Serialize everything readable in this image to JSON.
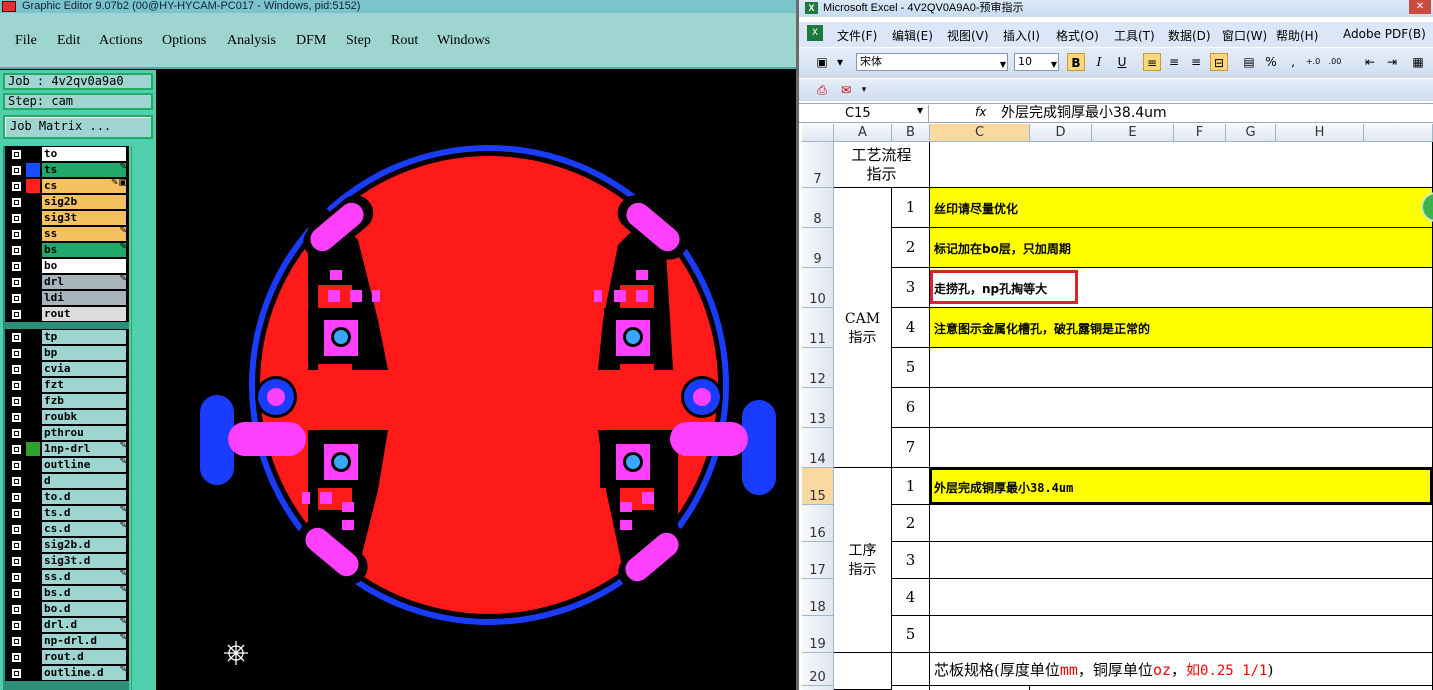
{
  "editor": {
    "title": "Graphic Editor 9.07b2 (00@HY-HYCAM-PC017 - Windows, pid:5152)",
    "menu": [
      "File",
      "Edit",
      "Actions",
      "Options",
      "Analysis",
      "DFM",
      "Step",
      "Rout",
      "Windows"
    ],
    "job_label": "Job : 4v2qv0a9a0",
    "step_label": "Step: cam",
    "job_matrix_button": "Job Matrix ...",
    "layers": [
      {
        "name": "to",
        "color": "#ffffff",
        "fill": "#000000",
        "marker": ""
      },
      {
        "name": "ts",
        "color": "#22a86a",
        "fill": "#1a4cff",
        "marker": "✎"
      },
      {
        "name": "cs",
        "color": "#f5c060",
        "fill": "#ff2020",
        "marker": "✎▣"
      },
      {
        "name": "sig2b",
        "color": "#f5c060",
        "fill": "#000000",
        "marker": ""
      },
      {
        "name": "sig3t",
        "color": "#f5c060",
        "fill": "#000000",
        "marker": ""
      },
      {
        "name": "ss",
        "color": "#f5c060",
        "fill": "#000000",
        "marker": "✎"
      },
      {
        "name": "bs",
        "color": "#22a86a",
        "fill": "#000000",
        "marker": "✎"
      },
      {
        "name": "bo",
        "color": "#ffffff",
        "fill": "#000000",
        "marker": ""
      },
      {
        "name": "drl",
        "color": "#a8b4bc",
        "fill": "#000000",
        "marker": "✎"
      },
      {
        "name": "ldi",
        "color": "#a8b4bc",
        "fill": "#000000",
        "marker": ""
      },
      {
        "name": "rout",
        "color": "#dcdcdc",
        "fill": "#000000",
        "marker": ""
      },
      {
        "name": "tp",
        "color": "#9fd5d1",
        "fill": "#000000",
        "marker": ""
      },
      {
        "name": "bp",
        "color": "#9fd5d1",
        "fill": "#000000",
        "marker": ""
      },
      {
        "name": "cvia",
        "color": "#9fd5d1",
        "fill": "#000000",
        "marker": ""
      },
      {
        "name": "fzt",
        "color": "#9fd5d1",
        "fill": "#000000",
        "marker": ""
      },
      {
        "name": "fzb",
        "color": "#9fd5d1",
        "fill": "#000000",
        "marker": ""
      },
      {
        "name": "roubk",
        "color": "#9fd5d1",
        "fill": "#000000",
        "marker": ""
      },
      {
        "name": "pthrou",
        "color": "#9fd5d1",
        "fill": "#000000",
        "marker": ""
      },
      {
        "name": "1np-drl",
        "color": "#9fd5d1",
        "fill": "#2ea02e",
        "marker": "✎"
      },
      {
        "name": "outline",
        "color": "#9fd5d1",
        "fill": "#000000",
        "marker": "✎"
      },
      {
        "name": "d",
        "color": "#9fd5d1",
        "fill": "#000000",
        "marker": ""
      },
      {
        "name": "to.d",
        "color": "#9fd5d1",
        "fill": "#000000",
        "marker": ""
      },
      {
        "name": "ts.d",
        "color": "#9fd5d1",
        "fill": "#000000",
        "marker": "✎"
      },
      {
        "name": "cs.d",
        "color": "#9fd5d1",
        "fill": "#000000",
        "marker": "✎"
      },
      {
        "name": "sig2b.d",
        "color": "#9fd5d1",
        "fill": "#000000",
        "marker": ""
      },
      {
        "name": "sig3t.d",
        "color": "#9fd5d1",
        "fill": "#000000",
        "marker": ""
      },
      {
        "name": "ss.d",
        "color": "#9fd5d1",
        "fill": "#000000",
        "marker": "✎"
      },
      {
        "name": "bs.d",
        "color": "#9fd5d1",
        "fill": "#000000",
        "marker": "✎"
      },
      {
        "name": "bo.d",
        "color": "#9fd5d1",
        "fill": "#000000",
        "marker": ""
      },
      {
        "name": "drl.d",
        "color": "#9fd5d1",
        "fill": "#000000",
        "marker": "✎"
      },
      {
        "name": "np-drl.d",
        "color": "#9fd5d1",
        "fill": "#000000",
        "marker": "✎"
      },
      {
        "name": "rout.d",
        "color": "#9fd5d1",
        "fill": "#000000",
        "marker": ""
      },
      {
        "name": "outline.d",
        "color": "#9fd5d1",
        "fill": "#000000",
        "marker": "✎"
      }
    ],
    "colors": {
      "board": "#ff1a1a",
      "outline": "#1a3cff",
      "pad": "#ff40ff",
      "hole": "#38a8ff",
      "background": "#000000"
    }
  },
  "excel": {
    "title": "Microsoft Excel - 4V2QV0A9A0-预审指示",
    "menu": [
      "文件(F)",
      "编辑(E)",
      "视图(V)",
      "插入(I)",
      "格式(O)",
      "工具(T)",
      "数据(D)",
      "窗口(W)",
      "帮助(H)",
      "Adobe PDF(B)"
    ],
    "font_name": "宋体",
    "font_size": "10",
    "name_box": "C15",
    "fx": "fx",
    "formula": "外层完成铜厚最小38.4um",
    "columns": [
      "A",
      "B",
      "C",
      "D",
      "E",
      "F",
      "G",
      "H"
    ],
    "rows": {
      "r7": {
        "num": "7",
        "a": "工艺流程\n指示"
      },
      "r8": {
        "num": "8",
        "b": "1",
        "c": "丝印请尽量优化"
      },
      "r9": {
        "num": "9",
        "b": "2",
        "c": "标记加在bo层，只加周期"
      },
      "r10": {
        "num": "10",
        "b": "3",
        "c": "走捞孔，np孔掏等大"
      },
      "r11": {
        "num": "11",
        "b": "4",
        "c": "注意图示金属化槽孔，破孔露铜是正常的"
      },
      "r12": {
        "num": "12",
        "b": "5"
      },
      "r13": {
        "num": "13",
        "b": "6"
      },
      "r14": {
        "num": "14",
        "b": "7"
      },
      "r15": {
        "num": "15",
        "b": "1",
        "c": "外层完成铜厚最小38.4um"
      },
      "r16": {
        "num": "16",
        "b": "2"
      },
      "r17": {
        "num": "17",
        "b": "3"
      },
      "r18": {
        "num": "18",
        "b": "4"
      },
      "r19": {
        "num": "19",
        "b": "5"
      },
      "r20": {
        "num": "20",
        "c_pre": "芯板规格(厚度单位",
        "c_mm": "mm",
        "c_mid": "，铜厚单位",
        "c_oz": "oz",
        "c_post": "，",
        "c_eg": "如0.25 1/1",
        ")": ")"
      }
    },
    "cam_label": "CAM\n指示",
    "process_label": "工序\n指示",
    "colors": {
      "highlight": "#ffff00",
      "red_note": "#ff0000",
      "annotation_box": "#d8242c"
    }
  }
}
